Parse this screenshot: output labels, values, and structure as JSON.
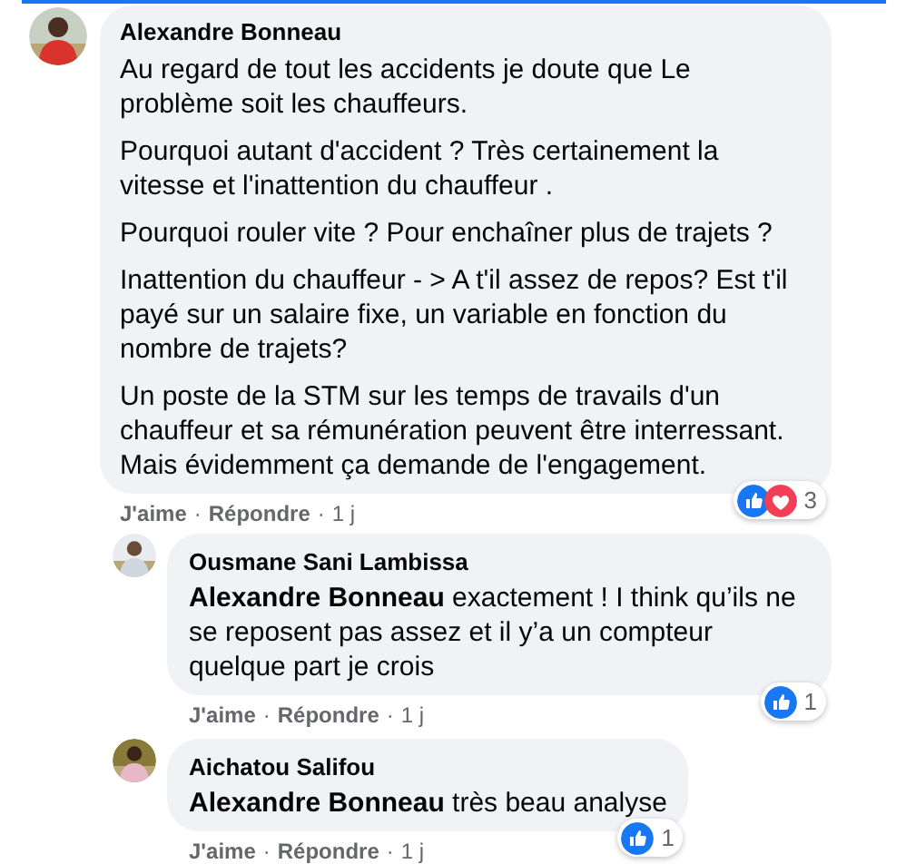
{
  "action_separator": "·",
  "comment": {
    "author": "Alexandre Bonneau",
    "paragraphs": [
      "Au regard de tout les accidents je doute que Le problème soit les chauffeurs.",
      "Pourquoi autant d'accident ? Très certainement la vitesse et l'inattention du chauffeur .",
      "Pourquoi rouler vite ? Pour enchaîner plus de trajets ?",
      "Inattention du chauffeur - > A t'il assez de repos? Est t'il payé sur un salaire fixe, un variable en fonction du nombre de trajets?",
      "Un poste de la STM sur les temps de travails d'un chauffeur et sa rémunération peuvent être interressant. Mais évidemment ça demande de l'engagement."
    ],
    "actions": [
      "J'aime",
      "Répondre",
      "1 j"
    ],
    "reactions": {
      "items": [
        {
          "kind": "like"
        },
        {
          "kind": "love"
        }
      ],
      "count": "3"
    },
    "replies": [
      {
        "author": "Ousmane Sani Lambissa",
        "text": "**Alexandre Bonneau** exactement ! I think qu’ils ne se reposent pas assez et il y’a un compteur quelque part je crois",
        "actions": [
          "J'aime",
          "Répondre",
          "1 j"
        ],
        "reactions": {
          "items": [
            {
              "kind": "like"
            }
          ],
          "count": "1"
        }
      },
      {
        "author": "Aichatou Salifou",
        "text": "**Alexandre Bonneau** très beau analyse",
        "actions": [
          "J'aime",
          "Répondre",
          "1 j"
        ],
        "reactions": {
          "items": [
            {
              "kind": "like"
            }
          ],
          "count": "1"
        }
      }
    ]
  }
}
